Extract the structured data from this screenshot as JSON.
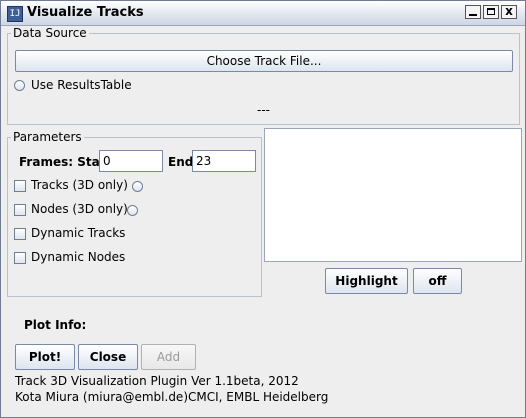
{
  "window": {
    "title": "Visualize Tracks",
    "minimize_glyph": "_",
    "maximize_glyph": "□",
    "close_glyph": "x",
    "app_icon_glyph": "IJ"
  },
  "data_source": {
    "group_label": "Data Source",
    "choose_button": "Choose Track File...",
    "use_results_label": "Use ResultsTable",
    "file_status": "---"
  },
  "parameters": {
    "group_label": "Parameters",
    "frames_start_label": "Frames: Start",
    "frames_start_value": "0",
    "frames_end_label": "End",
    "frames_end_value": "23",
    "options": [
      {
        "label": "Tracks (3D only)",
        "checked": false
      },
      {
        "label": "Nodes (3D only)",
        "checked": false
      },
      {
        "label": "Dynamic Tracks",
        "checked": false
      },
      {
        "label": "Dynamic Nodes",
        "checked": false
      }
    ]
  },
  "highlight": {
    "list_content": "",
    "highlight_button": "Highlight",
    "off_button": "off"
  },
  "plot": {
    "info_label": "Plot Info:",
    "plot_button": "Plot!",
    "close_button": "Close",
    "add_button": "Add"
  },
  "footer": {
    "line1": "Track 3D Visualization Plugin Ver 1.1beta, 2012",
    "line2": "Kota Miura (miura@embl.de)CMCI, EMBL Heidelberg"
  }
}
